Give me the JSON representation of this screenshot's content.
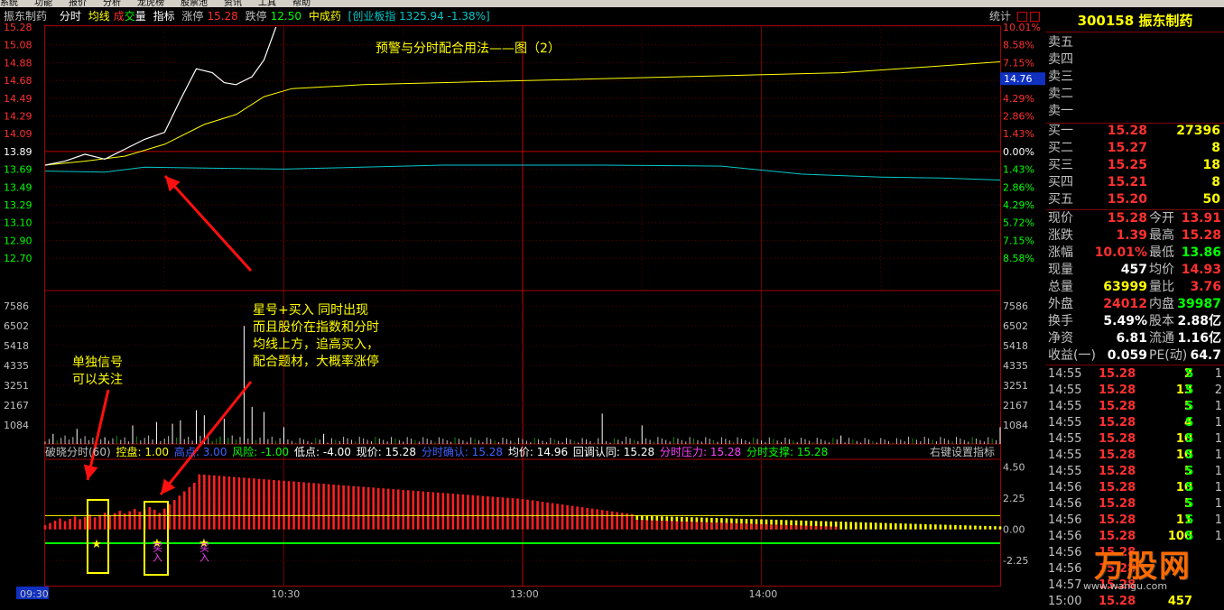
{
  "menu": [
    "系统",
    "功能",
    "报价",
    "分析",
    "龙虎榜",
    "股票池",
    "资讯",
    "工具",
    "帮助"
  ],
  "header": {
    "stock_name": "振东制药",
    "tab_fenshi": "分时",
    "tab_junxian": "均线",
    "tab_cheng": "成",
    "tab_jiao": "交",
    "tab_liang": "量",
    "tab_zhibiao": "指标",
    "zhangting_label": "涨停",
    "zhangting_value": "15.28",
    "dieting_label": "跌停",
    "dieting_value": "12.50",
    "index_name": "中成药",
    "board_info": "[创业板指 1325.94 -1.38%]",
    "stats_btn": "统计"
  },
  "colors": {
    "up": "#ff3030",
    "down": "#00ff00",
    "price": "#ffffff",
    "avg": "#ffff00",
    "index": "#00c8c8",
    "grid": "#800000"
  },
  "price_axis": {
    "left": [
      "15.28",
      "15.08",
      "14.88",
      "14.68",
      "14.49",
      "14.29",
      "14.09",
      "13.89",
      "13.69",
      "13.49",
      "13.29",
      "13.10",
      "12.90",
      "12.70"
    ],
    "right": [
      "10.01%",
      "8.58%",
      "7.15%",
      "5.72%",
      "4.29%",
      "2.86%",
      "1.43%",
      "0.00%",
      "1.43%",
      "2.86%",
      "4.29%",
      "5.72%",
      "7.15%",
      "8.58%"
    ],
    "current_tag": "14.76"
  },
  "volume_axis": {
    "labels": [
      "7586",
      "6502",
      "5418",
      "4335",
      "3251",
      "2167",
      "1084"
    ]
  },
  "indicator_axis": {
    "labels": [
      "4.50",
      "2.25",
      "0.00",
      "-2.25"
    ]
  },
  "time_axis": {
    "labels": [
      "09:30",
      "10:30",
      "13:00",
      "14:00"
    ]
  },
  "title_annotation": "预警与分时配合用法——图（2）",
  "annotations": {
    "star_text": [
      "星号+买入   同时出现",
      "而且股价在指数和分时",
      "均线上方，追高买入，",
      "配合题材，大概率涨停"
    ],
    "single_text": [
      "单独信号",
      "可以关注"
    ],
    "buy_label_1": "买入",
    "buy_label_2": "买入",
    "star_glyph": "★"
  },
  "indicator_header": {
    "name": "破晓分时(60)",
    "kongpan": "控盘: 1.00",
    "gaodian": "高点: 3.00",
    "fengxian": "风险: -1.00",
    "didian": "低点: -4.00",
    "xianjia": "现价: 15.28",
    "fenshi_queren": "分时确认: 15.28",
    "junjia": "均价: 14.96",
    "huitiao": "回调认同: 15.28",
    "yali": "分时压力: 15.28",
    "zhicheng": "分时支撑: 15.28",
    "settings": "右键设置指标"
  },
  "right_panel": {
    "code_name": "300158 振东制药",
    "sell": [
      {
        "label": "卖五",
        "price": "",
        "vol": ""
      },
      {
        "label": "卖四",
        "price": "",
        "vol": ""
      },
      {
        "label": "卖三",
        "price": "",
        "vol": ""
      },
      {
        "label": "卖二",
        "price": "",
        "vol": ""
      },
      {
        "label": "卖一",
        "price": "",
        "vol": ""
      }
    ],
    "buy": [
      {
        "label": "买一",
        "price": "15.28",
        "vol": "27396"
      },
      {
        "label": "买二",
        "price": "15.27",
        "vol": "8"
      },
      {
        "label": "买三",
        "price": "15.25",
        "vol": "18"
      },
      {
        "label": "买四",
        "price": "15.21",
        "vol": "8"
      },
      {
        "label": "买五",
        "price": "15.20",
        "vol": "50"
      }
    ],
    "quotes": [
      {
        "l1": "现价",
        "v1": "15.28",
        "c1": "#ff3030",
        "l2": "今开",
        "v2": "13.91",
        "c2": "#ff3030"
      },
      {
        "l1": "涨跌",
        "v1": "1.39",
        "c1": "#ff3030",
        "l2": "最高",
        "v2": "15.28",
        "c2": "#ff3030"
      },
      {
        "l1": "涨幅",
        "v1": "10.01%",
        "c1": "#ff3030",
        "l2": "最低",
        "v2": "13.86",
        "c2": "#00ff00"
      },
      {
        "l1": "现量",
        "v1": "457",
        "c1": "#ffffff",
        "l2": "均价",
        "v2": "14.93",
        "c2": "#ff3030"
      },
      {
        "l1": "总量",
        "v1": "63999",
        "c1": "#ffff00",
        "l2": "量比",
        "v2": "3.76",
        "c2": "#ff3030"
      },
      {
        "l1": "外盘",
        "v1": "24012",
        "c1": "#ff3030",
        "l2": "内盘",
        "v2": "39987",
        "c2": "#00ff00"
      },
      {
        "l1": "换手",
        "v1": "5.49%",
        "c1": "#ffffff",
        "l2": "股本",
        "v2": "2.88亿",
        "c2": "#ffffff"
      },
      {
        "l1": "净资",
        "v1": "6.81",
        "c1": "#ffffff",
        "l2": "流通",
        "v2": "1.16亿",
        "c2": "#ffffff"
      },
      {
        "l1": "收益(一)",
        "v1": "0.059",
        "c1": "#ffffff",
        "l2": "PE(动)",
        "v2": "64.7",
        "c2": "#ffffff"
      }
    ],
    "ticks": [
      {
        "t": "14:55",
        "p": "15.28",
        "v": "2",
        "s": "S",
        "n": "1"
      },
      {
        "t": "14:55",
        "p": "15.28",
        "v": "13",
        "s": "S",
        "n": "2"
      },
      {
        "t": "14:55",
        "p": "15.28",
        "v": "5",
        "s": "S",
        "n": "1"
      },
      {
        "t": "14:55",
        "p": "15.28",
        "v": "4",
        "s": "S",
        "n": "1"
      },
      {
        "t": "14:55",
        "p": "15.28",
        "v": "10",
        "s": "S",
        "n": "1"
      },
      {
        "t": "14:55",
        "p": "15.28",
        "v": "10",
        "s": "S",
        "n": "1"
      },
      {
        "t": "14:55",
        "p": "15.28",
        "v": "5",
        "s": "S",
        "n": "1"
      },
      {
        "t": "14:56",
        "p": "15.28",
        "v": "10",
        "s": "S",
        "n": "1"
      },
      {
        "t": "14:56",
        "p": "15.28",
        "v": "5",
        "s": "S",
        "n": "1"
      },
      {
        "t": "14:56",
        "p": "15.28",
        "v": "11",
        "s": "S",
        "n": "1"
      },
      {
        "t": "14:56",
        "p": "15.28",
        "v": "100",
        "s": "S",
        "n": "1"
      },
      {
        "t": "14:56",
        "p": "15.28",
        "v": "",
        "s": "",
        "n": ""
      },
      {
        "t": "14:56",
        "p": "15.28",
        "v": "",
        "s": "",
        "n": ""
      },
      {
        "t": "14:57",
        "p": "15.28",
        "v": "",
        "s": "",
        "n": ""
      },
      {
        "t": "15:00",
        "p": "15.28",
        "v": "457",
        "s": "",
        "n": ""
      }
    ]
  },
  "watermark": {
    "text": "万股网",
    "url": "www.wangu.com"
  },
  "chart_data": {
    "type": "line",
    "title": "",
    "price_ylim": [
      12.5,
      15.28
    ],
    "pre_close": 13.89,
    "price_series": [
      {
        "t": 0,
        "v": 13.89
      },
      {
        "t": 5,
        "v": 13.93
      },
      {
        "t": 10,
        "v": 14.0
      },
      {
        "t": 15,
        "v": 13.95
      },
      {
        "t": 20,
        "v": 14.05
      },
      {
        "t": 25,
        "v": 14.15
      },
      {
        "t": 30,
        "v": 14.22
      },
      {
        "t": 34,
        "v": 14.55
      },
      {
        "t": 38,
        "v": 14.86
      },
      {
        "t": 42,
        "v": 14.82
      },
      {
        "t": 45,
        "v": 14.72
      },
      {
        "t": 48,
        "v": 14.7
      },
      {
        "t": 52,
        "v": 14.78
      },
      {
        "t": 55,
        "v": 14.95
      },
      {
        "t": 58,
        "v": 15.28
      }
    ],
    "avg_series": [
      {
        "t": 0,
        "v": 13.89
      },
      {
        "t": 10,
        "v": 13.93
      },
      {
        "t": 20,
        "v": 13.98
      },
      {
        "t": 30,
        "v": 14.1
      },
      {
        "t": 40,
        "v": 14.3
      },
      {
        "t": 48,
        "v": 14.4
      },
      {
        "t": 55,
        "v": 14.58
      },
      {
        "t": 62,
        "v": 14.66
      },
      {
        "t": 80,
        "v": 14.7
      },
      {
        "t": 120,
        "v": 14.74
      },
      {
        "t": 160,
        "v": 14.78
      },
      {
        "t": 200,
        "v": 14.82
      },
      {
        "t": 240,
        "v": 14.93
      }
    ],
    "index_series": [
      {
        "t": 0,
        "v": 13.83
      },
      {
        "t": 15,
        "v": 13.82
      },
      {
        "t": 25,
        "v": 13.87
      },
      {
        "t": 40,
        "v": 13.86
      },
      {
        "t": 60,
        "v": 13.85
      },
      {
        "t": 100,
        "v": 13.89
      },
      {
        "t": 140,
        "v": 13.89
      },
      {
        "t": 170,
        "v": 13.88
      },
      {
        "t": 190,
        "v": 13.8
      },
      {
        "t": 210,
        "v": 13.77
      },
      {
        "t": 225,
        "v": 13.76
      },
      {
        "t": 240,
        "v": 13.74
      }
    ],
    "volume_ylim": [
      0,
      8670
    ],
    "volume_spikes": [
      {
        "t": 2,
        "v": 600
      },
      {
        "t": 8,
        "v": 900
      },
      {
        "t": 15,
        "v": 400
      },
      {
        "t": 22,
        "v": 1100
      },
      {
        "t": 28,
        "v": 1300
      },
      {
        "t": 32,
        "v": 1200
      },
      {
        "t": 34,
        "v": 1400
      },
      {
        "t": 38,
        "v": 2000
      },
      {
        "t": 40,
        "v": 1700
      },
      {
        "t": 45,
        "v": 1500
      },
      {
        "t": 50,
        "v": 7000
      },
      {
        "t": 52,
        "v": 2200
      },
      {
        "t": 55,
        "v": 1900
      },
      {
        "t": 60,
        "v": 1000
      },
      {
        "t": 70,
        "v": 600
      },
      {
        "t": 140,
        "v": 1800
      },
      {
        "t": 150,
        "v": 1100
      },
      {
        "t": 200,
        "v": 500
      },
      {
        "t": 240,
        "v": 1000
      }
    ],
    "indicator_ylim": [
      -4.0,
      5.0
    ],
    "indicator_red_peak_t": 38,
    "indicator_switch_t": 148,
    "axes_time_labels": [
      "09:30",
      "10:30",
      "13:00",
      "14:00"
    ]
  }
}
